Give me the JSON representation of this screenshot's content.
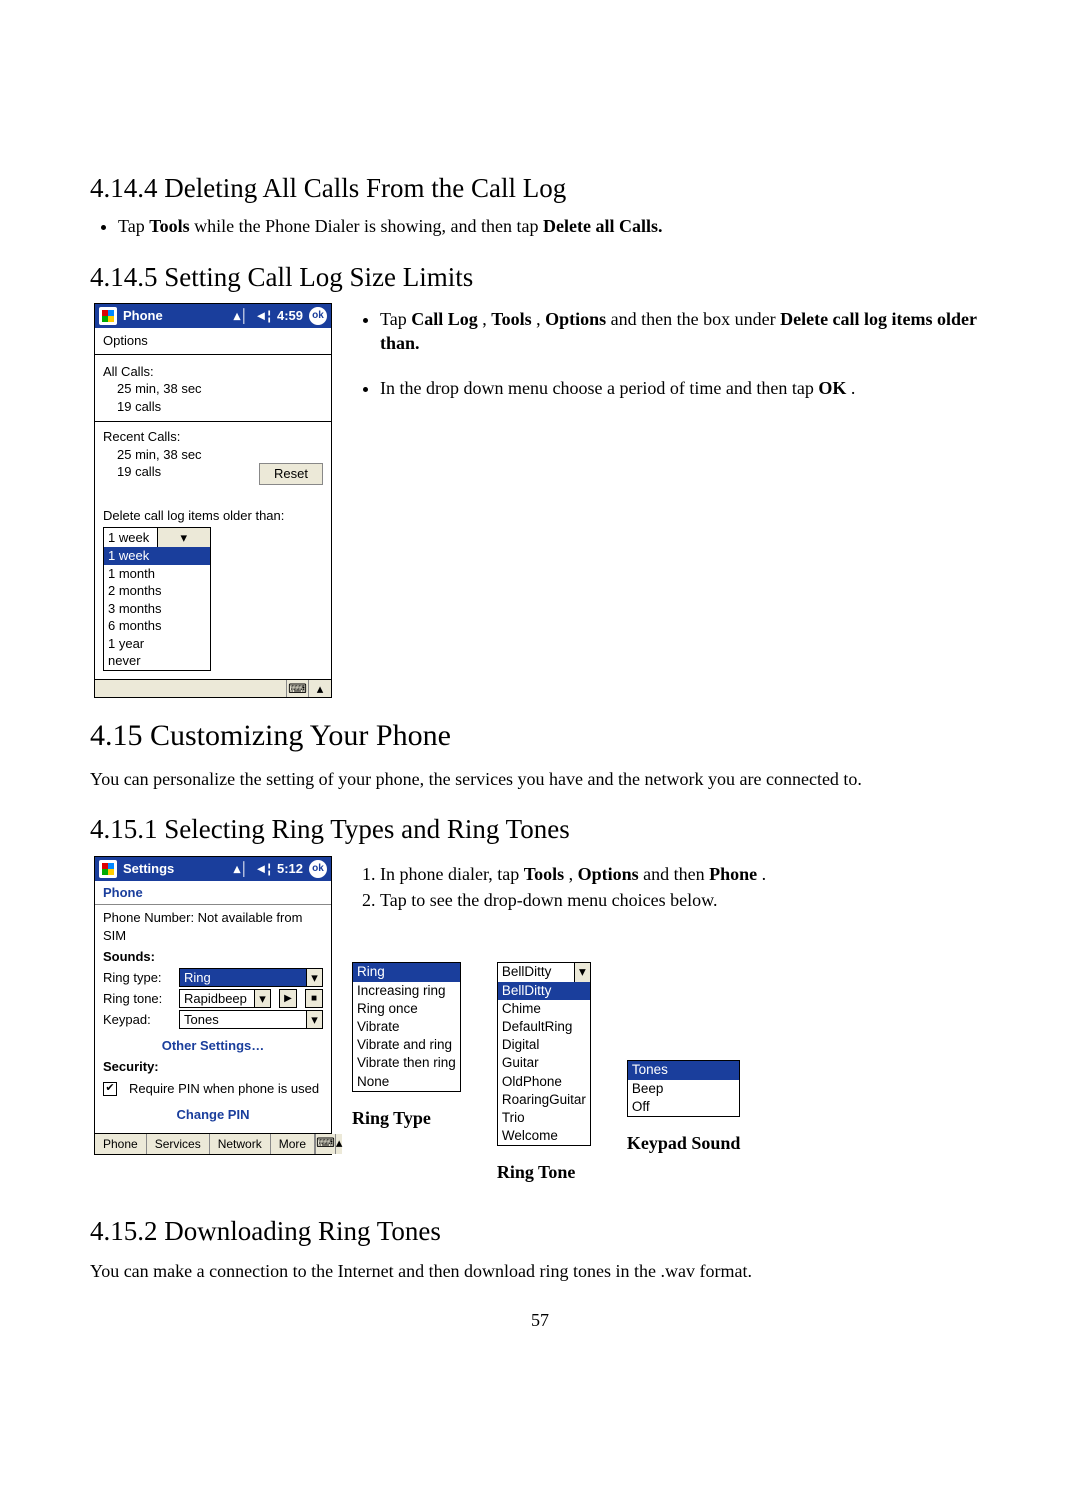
{
  "sec_4_14_4": {
    "heading": "4.14.4 Deleting All Calls From the Call Log",
    "bullet": {
      "pre": "Tap ",
      "b1": "Tools",
      "mid": " while the Phone Dialer is showing, and then tap ",
      "b2": "Delete all Calls."
    }
  },
  "sec_4_14_5": {
    "heading": "4.14.5 Setting Call Log Size Limits",
    "side": {
      "li1": {
        "t0": "Tap ",
        "b1": "Call Log",
        "t1": ", ",
        "b2": "Tools",
        "t2": ", ",
        "b3": "Options",
        "t3": " and then the box under ",
        "b4": "Delete call log items older than."
      },
      "li2": {
        "t0": "In the drop down menu choose a period of time and then tap ",
        "b1": "OK",
        "t1": "."
      }
    }
  },
  "fig1": {
    "title": "Phone",
    "time": "4:59",
    "ok": "ok",
    "options": "Options",
    "all_calls": "All Calls:",
    "all_dur": "25 min, 38 sec",
    "all_cnt": "19 calls",
    "recent": "Recent Calls:",
    "recent_dur": "25 min, 38 sec",
    "recent_cnt": "19 calls",
    "reset": "Reset",
    "del_label": "Delete call log items older than:",
    "dd_selected": "1 week",
    "dd_items": [
      "1 week",
      "1 month",
      "2 months",
      "3 months",
      "6 months",
      "1 year",
      "never"
    ]
  },
  "sec_4_15": {
    "heading": "4.15  Customizing Your Phone",
    "intro": "You can personalize the setting of your phone, the services you have and the network you are connected to."
  },
  "sec_4_15_1": {
    "heading": "4.15.1 Selecting Ring Types and Ring Tones",
    "ol": {
      "li1": {
        "t0": "In phone dialer, tap ",
        "b1": "Tools",
        "t1": ", ",
        "b2": "Options",
        "t2": " and then ",
        "b3": "Phone",
        "t3": "."
      },
      "li2": "Tap to see the drop-down menu choices below."
    }
  },
  "fig2": {
    "title": "Settings",
    "time": "5:12",
    "ok": "ok",
    "phone_tab": "Phone",
    "pn_label": "Phone Number: Not available from SIM",
    "sounds": "Sounds:",
    "ring_type_l": "Ring type:",
    "ring_type_v": "Ring",
    "ring_tone_l": "Ring tone:",
    "ring_tone_v": "Rapidbeep",
    "keypad_l": "Keypad:",
    "keypad_v": "Tones",
    "other": "Other Settings…",
    "security": "Security:",
    "pin_label": "Require PIN when phone is used",
    "change_pin": "Change PIN",
    "tabs": [
      "Phone",
      "Services",
      "Network",
      "More"
    ]
  },
  "popup_ringtype": {
    "items": [
      "Ring",
      "Increasing ring",
      "Ring once",
      "Vibrate",
      "Vibrate and ring",
      "Vibrate then ring",
      "None"
    ],
    "caption": "Ring Type"
  },
  "popup_ringtone": {
    "selected": "BellDitty",
    "items": [
      "BellDitty",
      "Chime",
      "DefaultRing",
      "Digital",
      "Guitar",
      "OldPhone",
      "RoaringGuitar",
      "Trio",
      "Welcome"
    ],
    "caption": "Ring Tone"
  },
  "popup_keypad": {
    "items": [
      "Tones",
      "Beep",
      "Off"
    ],
    "caption": "Keypad Sound"
  },
  "sec_4_15_2": {
    "heading": "4.15.2 Downloading Ring Tones",
    "body": "You can make a connection to the Internet and then download ring tones in the .wav format."
  },
  "page_number": "57"
}
